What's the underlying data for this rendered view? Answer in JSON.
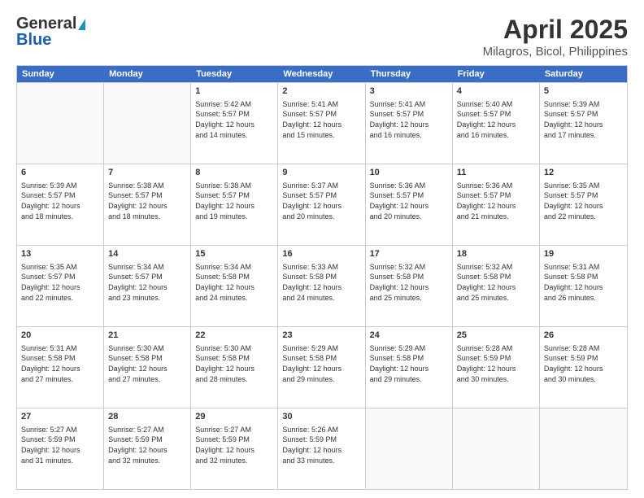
{
  "logo": {
    "line1": "General",
    "line2": "Blue"
  },
  "title": "April 2025",
  "subtitle": "Milagros, Bicol, Philippines",
  "header": {
    "days": [
      "Sunday",
      "Monday",
      "Tuesday",
      "Wednesday",
      "Thursday",
      "Friday",
      "Saturday"
    ]
  },
  "rows": [
    [
      {
        "day": "",
        "empty": true
      },
      {
        "day": "",
        "empty": true
      },
      {
        "day": "1",
        "sunrise": "5:42 AM",
        "sunset": "5:57 PM",
        "daylight": "12 hours and 14 minutes."
      },
      {
        "day": "2",
        "sunrise": "5:41 AM",
        "sunset": "5:57 PM",
        "daylight": "12 hours and 15 minutes."
      },
      {
        "day": "3",
        "sunrise": "5:41 AM",
        "sunset": "5:57 PM",
        "daylight": "12 hours and 16 minutes."
      },
      {
        "day": "4",
        "sunrise": "5:40 AM",
        "sunset": "5:57 PM",
        "daylight": "12 hours and 16 minutes."
      },
      {
        "day": "5",
        "sunrise": "5:39 AM",
        "sunset": "5:57 PM",
        "daylight": "12 hours and 17 minutes."
      }
    ],
    [
      {
        "day": "6",
        "sunrise": "5:39 AM",
        "sunset": "5:57 PM",
        "daylight": "12 hours and 18 minutes."
      },
      {
        "day": "7",
        "sunrise": "5:38 AM",
        "sunset": "5:57 PM",
        "daylight": "12 hours and 18 minutes."
      },
      {
        "day": "8",
        "sunrise": "5:38 AM",
        "sunset": "5:57 PM",
        "daylight": "12 hours and 19 minutes."
      },
      {
        "day": "9",
        "sunrise": "5:37 AM",
        "sunset": "5:57 PM",
        "daylight": "12 hours and 20 minutes."
      },
      {
        "day": "10",
        "sunrise": "5:36 AM",
        "sunset": "5:57 PM",
        "daylight": "12 hours and 20 minutes."
      },
      {
        "day": "11",
        "sunrise": "5:36 AM",
        "sunset": "5:57 PM",
        "daylight": "12 hours and 21 minutes."
      },
      {
        "day": "12",
        "sunrise": "5:35 AM",
        "sunset": "5:57 PM",
        "daylight": "12 hours and 22 minutes."
      }
    ],
    [
      {
        "day": "13",
        "sunrise": "5:35 AM",
        "sunset": "5:57 PM",
        "daylight": "12 hours and 22 minutes."
      },
      {
        "day": "14",
        "sunrise": "5:34 AM",
        "sunset": "5:57 PM",
        "daylight": "12 hours and 23 minutes."
      },
      {
        "day": "15",
        "sunrise": "5:34 AM",
        "sunset": "5:58 PM",
        "daylight": "12 hours and 24 minutes."
      },
      {
        "day": "16",
        "sunrise": "5:33 AM",
        "sunset": "5:58 PM",
        "daylight": "12 hours and 24 minutes."
      },
      {
        "day": "17",
        "sunrise": "5:32 AM",
        "sunset": "5:58 PM",
        "daylight": "12 hours and 25 minutes."
      },
      {
        "day": "18",
        "sunrise": "5:32 AM",
        "sunset": "5:58 PM",
        "daylight": "12 hours and 25 minutes."
      },
      {
        "day": "19",
        "sunrise": "5:31 AM",
        "sunset": "5:58 PM",
        "daylight": "12 hours and 26 minutes."
      }
    ],
    [
      {
        "day": "20",
        "sunrise": "5:31 AM",
        "sunset": "5:58 PM",
        "daylight": "12 hours and 27 minutes."
      },
      {
        "day": "21",
        "sunrise": "5:30 AM",
        "sunset": "5:58 PM",
        "daylight": "12 hours and 27 minutes."
      },
      {
        "day": "22",
        "sunrise": "5:30 AM",
        "sunset": "5:58 PM",
        "daylight": "12 hours and 28 minutes."
      },
      {
        "day": "23",
        "sunrise": "5:29 AM",
        "sunset": "5:58 PM",
        "daylight": "12 hours and 29 minutes."
      },
      {
        "day": "24",
        "sunrise": "5:29 AM",
        "sunset": "5:58 PM",
        "daylight": "12 hours and 29 minutes."
      },
      {
        "day": "25",
        "sunrise": "5:28 AM",
        "sunset": "5:59 PM",
        "daylight": "12 hours and 30 minutes."
      },
      {
        "day": "26",
        "sunrise": "5:28 AM",
        "sunset": "5:59 PM",
        "daylight": "12 hours and 30 minutes."
      }
    ],
    [
      {
        "day": "27",
        "sunrise": "5:27 AM",
        "sunset": "5:59 PM",
        "daylight": "12 hours and 31 minutes."
      },
      {
        "day": "28",
        "sunrise": "5:27 AM",
        "sunset": "5:59 PM",
        "daylight": "12 hours and 32 minutes."
      },
      {
        "day": "29",
        "sunrise": "5:27 AM",
        "sunset": "5:59 PM",
        "daylight": "12 hours and 32 minutes."
      },
      {
        "day": "30",
        "sunrise": "5:26 AM",
        "sunset": "5:59 PM",
        "daylight": "12 hours and 33 minutes."
      },
      {
        "day": "",
        "empty": true
      },
      {
        "day": "",
        "empty": true
      },
      {
        "day": "",
        "empty": true
      }
    ]
  ],
  "labels": {
    "sunrise": "Sunrise:",
    "sunset": "Sunset:",
    "daylight": "Daylight:"
  }
}
